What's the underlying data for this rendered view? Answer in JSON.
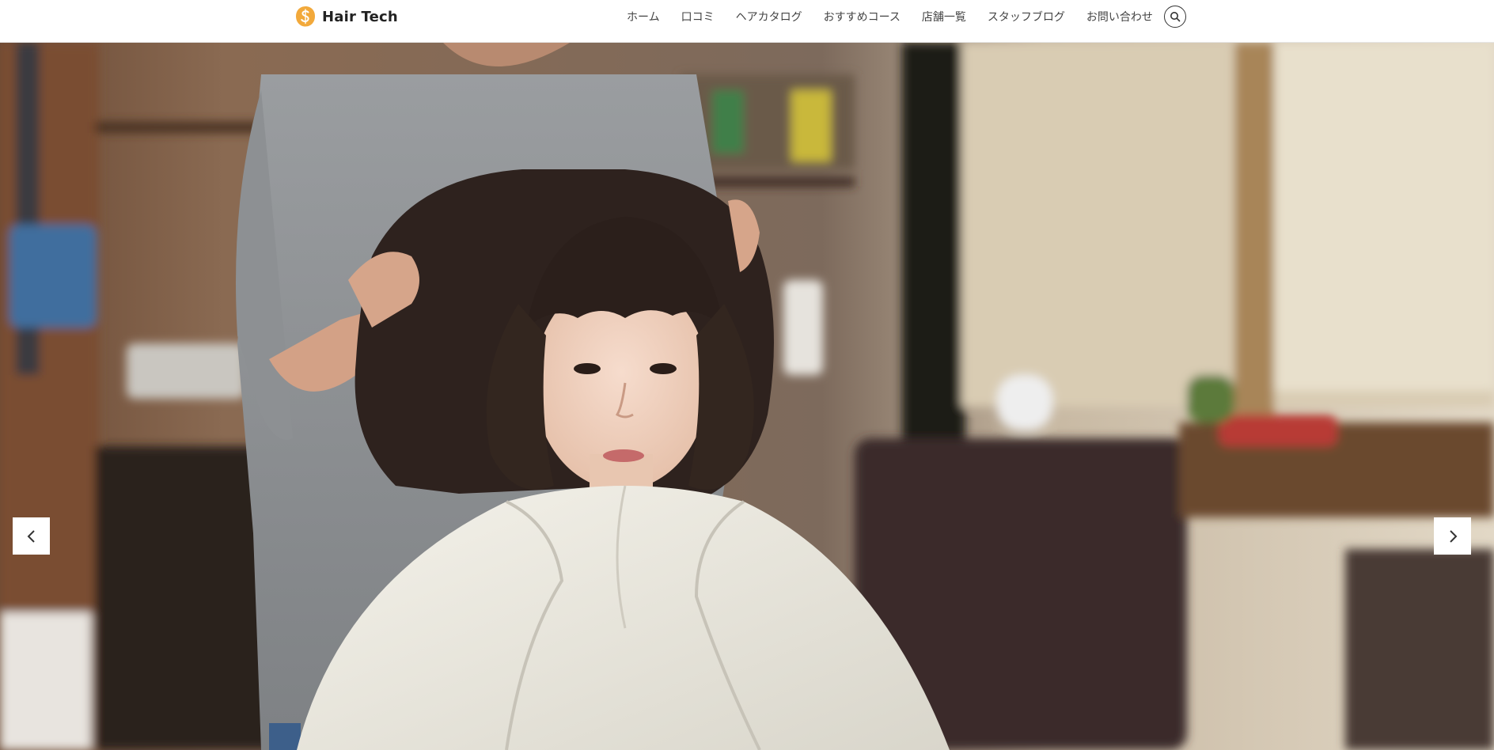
{
  "header": {
    "logo_text": "Hair Tech",
    "logo_icon": "s-circle-logo-icon",
    "nav": [
      {
        "label": "ホーム"
      },
      {
        "label": "口コミ"
      },
      {
        "label": "ヘアカタログ"
      },
      {
        "label": "おすすめコース"
      },
      {
        "label": "店舗一覧"
      },
      {
        "label": "スタッフブログ"
      },
      {
        "label": "お問い合わせ"
      }
    ],
    "search_icon": "search-icon"
  },
  "hero": {
    "image_subject": "salon-haircut-photo",
    "prev_icon": "chevron-left-icon",
    "next_icon": "chevron-right-icon"
  },
  "colors": {
    "logo_accent": "#F2A93B",
    "nav_text": "#444444",
    "header_bg": "#FFFFFF"
  }
}
